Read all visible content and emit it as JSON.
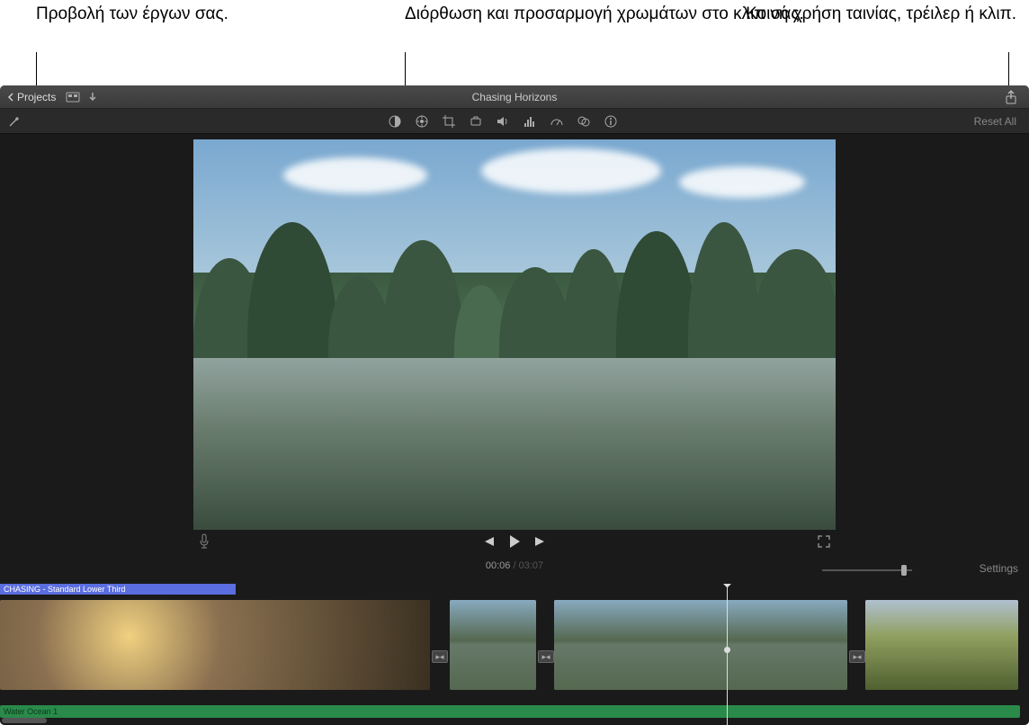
{
  "annotations": {
    "projects": "Προβολή των έργων σας.",
    "color": "Διόρθωση και προσαρμογή χρωμάτων στο κλιπ σας.",
    "share": "Κοινή χρήση ταινίας, τρέιλερ ή κλιπ."
  },
  "topbar": {
    "projects_label": "Projects",
    "title": "Chasing Horizons"
  },
  "toolbar": {
    "reset_all": "Reset All"
  },
  "timecode": {
    "current": "00:06",
    "separator": " / ",
    "duration": "03:07"
  },
  "settings_label": "Settings",
  "timeline": {
    "title_track": "CHASING - Standard Lower Third",
    "audio_track": "Water Ocean 1"
  },
  "icons": {
    "chevron_left": "chevron-left-icon",
    "media": "media-browser-icon",
    "import": "import-arrow-icon",
    "share": "share-icon",
    "magic_wand": "magic-wand-icon",
    "color_balance": "color-balance-icon",
    "color_wheel": "color-wheel-icon",
    "crop": "crop-icon",
    "stabilize": "stabilize-icon",
    "volume": "volume-icon",
    "eq": "equalizer-icon",
    "speed": "speed-gauge-icon",
    "filter": "filter-icon",
    "info": "info-icon",
    "mic": "microphone-icon",
    "prev": "previous-icon",
    "play": "play-icon",
    "next": "next-icon",
    "fullscreen": "fullscreen-icon",
    "transition": "transition-icon"
  }
}
